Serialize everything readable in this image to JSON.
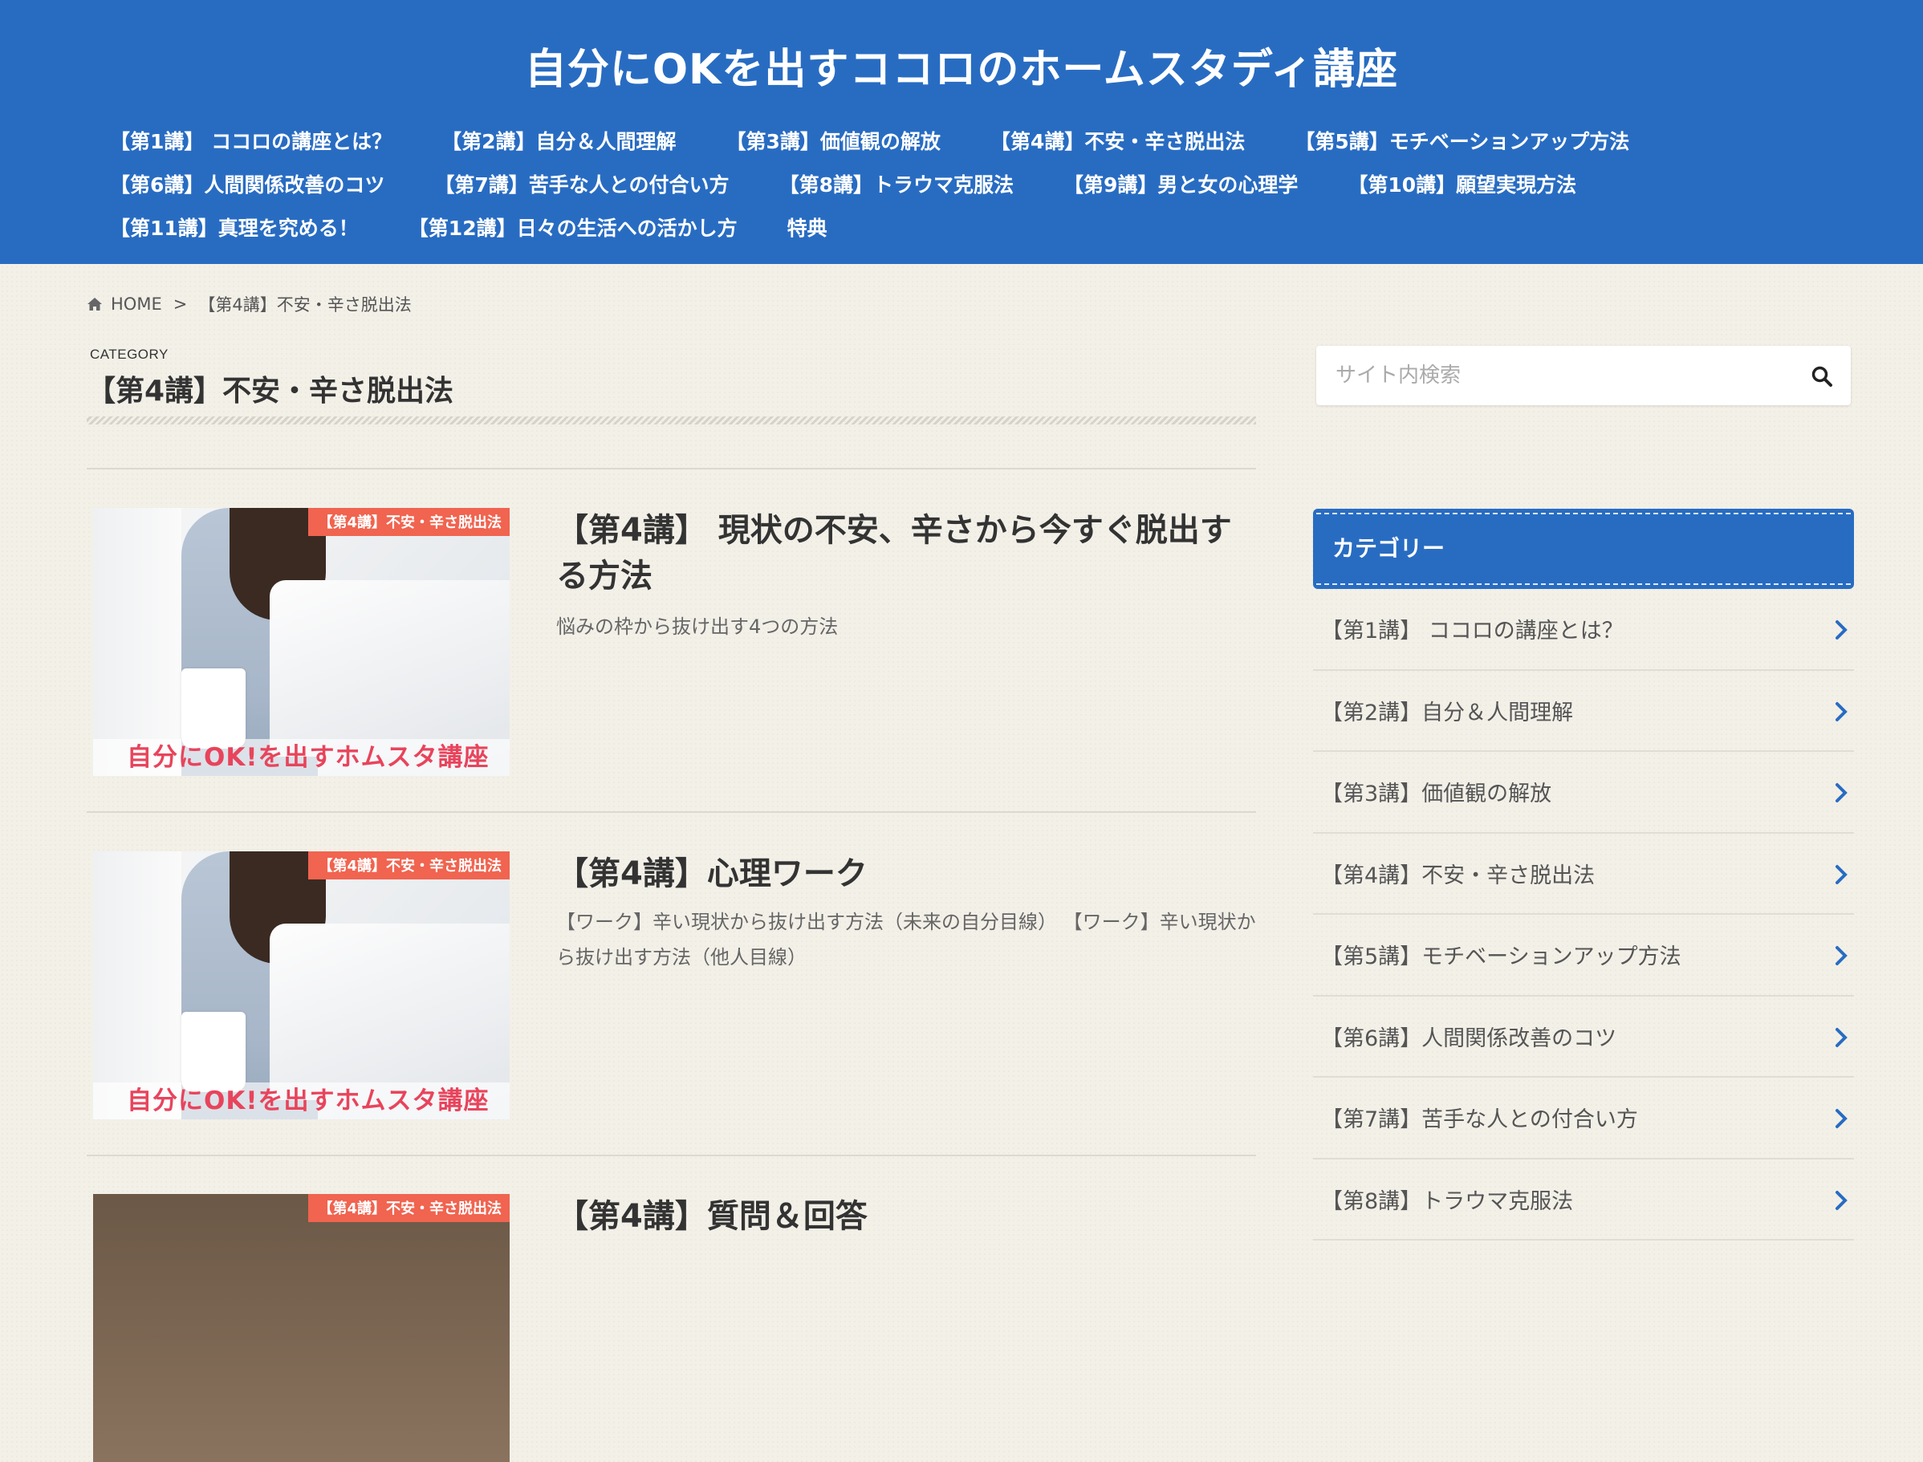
{
  "header": {
    "site_title": "自分にOKを出すココロのホームスタディ講座",
    "nav_rows": [
      [
        "【第1講】 ココロの講座とは？",
        "【第2講】自分＆人間理解",
        "【第3講】価値観の解放",
        "【第4講】不安・辛さ脱出法",
        "【第5講】モチベーションアップ方法"
      ],
      [
        "【第6講】人間関係改善のコツ",
        "【第7講】苦手な人との付合い方",
        "【第8講】トラウマ克服法",
        "【第9講】男と女の心理学",
        "【第10講】願望実現方法"
      ],
      [
        "【第11講】真理を究める！",
        "【第12講】日々の生活への活かし方",
        "特典"
      ]
    ]
  },
  "breadcrumb": {
    "home": "HOME",
    "sep": ">",
    "current": "【第4講】不安・辛さ脱出法"
  },
  "category": {
    "label": "CATEGORY",
    "title": "【第4講】不安・辛さ脱出法"
  },
  "articles": [
    {
      "badge": "【第4講】不安・辛さ脱出法",
      "thumb_text": "自分にOK!を出すホムスタ講座",
      "title": "【第4講】 現状の不安、辛さから今すぐ脱出する方法",
      "excerpt": "悩みの枠から抜け出す4つの方法"
    },
    {
      "badge": "【第4講】不安・辛さ脱出法",
      "thumb_text": "自分にOK!を出すホムスタ講座",
      "title": "【第4講】心理ワーク",
      "excerpt": "【ワーク】辛い現状から抜け出す方法（未来の自分目線） 【ワーク】辛い現状から抜け出す方法（他人目線）"
    },
    {
      "badge": "【第4講】不安・辛さ脱出法",
      "title": "【第4講】質問＆回答"
    }
  ],
  "sidebar": {
    "search_placeholder": "サイト内検索",
    "widget_title": "カテゴリー",
    "categories": [
      "【第1講】 ココロの講座とは？",
      "【第2講】自分＆人間理解",
      "【第3講】価値観の解放",
      "【第4講】不安・辛さ脱出法",
      "【第5講】モチベーションアップ方法",
      "【第6講】人間関係改善のコツ",
      "【第7講】苦手な人との付合い方",
      "【第8講】トラウマ克服法"
    ]
  },
  "colors": {
    "brand": "#286cc2",
    "badge": "#f06450",
    "thumb_text": "#e8445c"
  },
  "icons": {
    "home": "home-icon",
    "search": "search-icon",
    "chevron": "chevron-right-icon"
  }
}
